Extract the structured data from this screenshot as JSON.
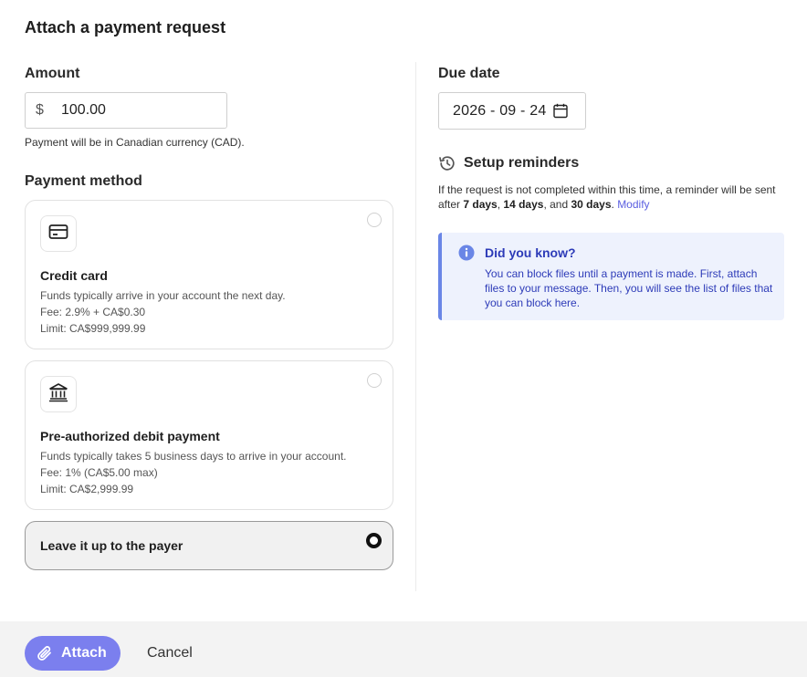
{
  "dialog": {
    "title": "Attach a payment request"
  },
  "amount": {
    "label": "Amount",
    "currency_symbol": "$",
    "value": "100.00",
    "help": "Payment will be in Canadian currency (CAD)."
  },
  "payment_method": {
    "label": "Payment method",
    "options": [
      {
        "icon": "credit-card-icon",
        "title": "Credit card",
        "lines": [
          "Funds typically arrive in your account the next day.",
          "Fee: 2.9% + CA$0.30",
          "Limit: CA$999,999.99"
        ],
        "selected": false
      },
      {
        "icon": "bank-icon",
        "title": "Pre-authorized debit payment",
        "lines": [
          "Funds typically takes 5 business days to arrive in your account.",
          "Fee: 1% (CA$5.00 max)",
          "Limit: CA$2,999.99"
        ],
        "selected": false
      },
      {
        "title": "Leave it up to the payer",
        "selected": true
      }
    ]
  },
  "due_date": {
    "label": "Due date",
    "value": "2026 - 09 - 24",
    "icon": "calendar-icon"
  },
  "reminders": {
    "icon": "history-icon",
    "title": "Setup reminders",
    "text_before": "If the request is not completed within this time, a reminder will be sent after ",
    "d1": "7 days",
    "sep1": ", ",
    "d2": "14 days",
    "sep2": ", and ",
    "d3": "30 days",
    "sep3": ". ",
    "modify_link": "Modify"
  },
  "info": {
    "icon": "info-icon",
    "title": "Did you know?",
    "body": "You can block files until a payment is made. First, attach files to your message. Then, you will see the list of files that you can block here."
  },
  "footer": {
    "attach_label": "Attach",
    "attach_icon": "paperclip-icon",
    "cancel_label": "Cancel"
  },
  "colors": {
    "accent": "#7b7fee",
    "info_bg": "#eef2fd",
    "info_text": "#2d3bb8",
    "link": "#5a5ee0"
  }
}
